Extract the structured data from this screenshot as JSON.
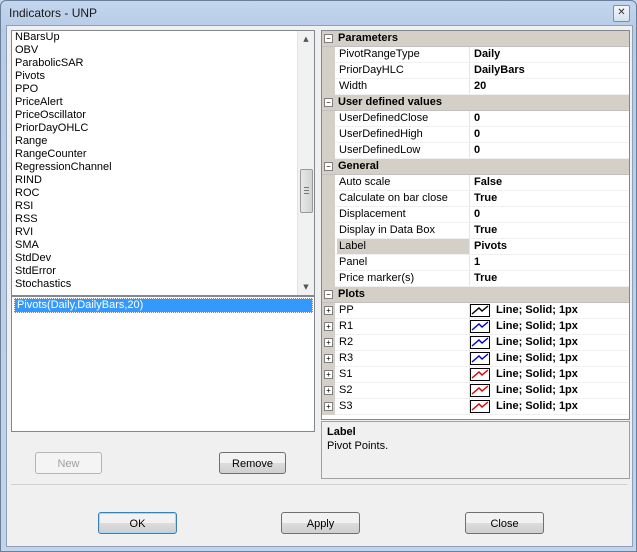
{
  "window": {
    "title": "Indicators - UNP",
    "close_glyph": "✕"
  },
  "indicator_list": {
    "items": [
      "NBarsUp",
      "OBV",
      "ParabolicSAR",
      "Pivots",
      "PPO",
      "PriceAlert",
      "PriceOscillator",
      "PriorDayOHLC",
      "Range",
      "RangeCounter",
      "RegressionChannel",
      "RIND",
      "ROC",
      "RSI",
      "RSS",
      "RVI",
      "SMA",
      "StdDev",
      "StdError",
      "Stochastics"
    ]
  },
  "configured_list": {
    "items": [
      "Pivots(Daily,DailyBars,20)"
    ]
  },
  "buttons": {
    "new": "New",
    "remove": "Remove",
    "ok": "OK",
    "apply": "Apply",
    "close": "Close"
  },
  "property_grid": {
    "toggle_glyph": "−",
    "expand_glyph": "+",
    "parameters": {
      "label": "Parameters",
      "rows": [
        {
          "name": "PivotRangeType",
          "value": "Daily"
        },
        {
          "name": "PriorDayHLC",
          "value": "DailyBars"
        },
        {
          "name": "Width",
          "value": "20"
        }
      ]
    },
    "user_defined": {
      "label": "User defined values",
      "rows": [
        {
          "name": "UserDefinedClose",
          "value": "0"
        },
        {
          "name": "UserDefinedHigh",
          "value": "0"
        },
        {
          "name": "UserDefinedLow",
          "value": "0"
        }
      ]
    },
    "general": {
      "label": "General",
      "rows": [
        {
          "name": "Auto scale",
          "value": "False"
        },
        {
          "name": "Calculate on bar close",
          "value": "True"
        },
        {
          "name": "Displacement",
          "value": "0"
        },
        {
          "name": "Display in Data Box",
          "value": "True"
        },
        {
          "name": "Label",
          "value": "Pivots"
        },
        {
          "name": "Panel",
          "value": "1"
        },
        {
          "name": "Price marker(s)",
          "value": "True"
        }
      ]
    },
    "plots": {
      "label": "Plots",
      "rows": [
        {
          "name": "PP",
          "value": "Line; Solid; 1px",
          "color": "#000000"
        },
        {
          "name": "R1",
          "value": "Line; Solid; 1px",
          "color": "#0000cc"
        },
        {
          "name": "R2",
          "value": "Line; Solid; 1px",
          "color": "#0000cc"
        },
        {
          "name": "R3",
          "value": "Line; Solid; 1px",
          "color": "#0000cc"
        },
        {
          "name": "S1",
          "value": "Line; Solid; 1px",
          "color": "#dd0000"
        },
        {
          "name": "S2",
          "value": "Line; Solid; 1px",
          "color": "#dd0000"
        },
        {
          "name": "S3",
          "value": "Line; Solid; 1px",
          "color": "#dd0000"
        }
      ]
    }
  },
  "help": {
    "title": "Label",
    "description": "Pivot Points."
  },
  "scrollbar": {
    "up_glyph": "▲",
    "down_glyph": "▼"
  }
}
